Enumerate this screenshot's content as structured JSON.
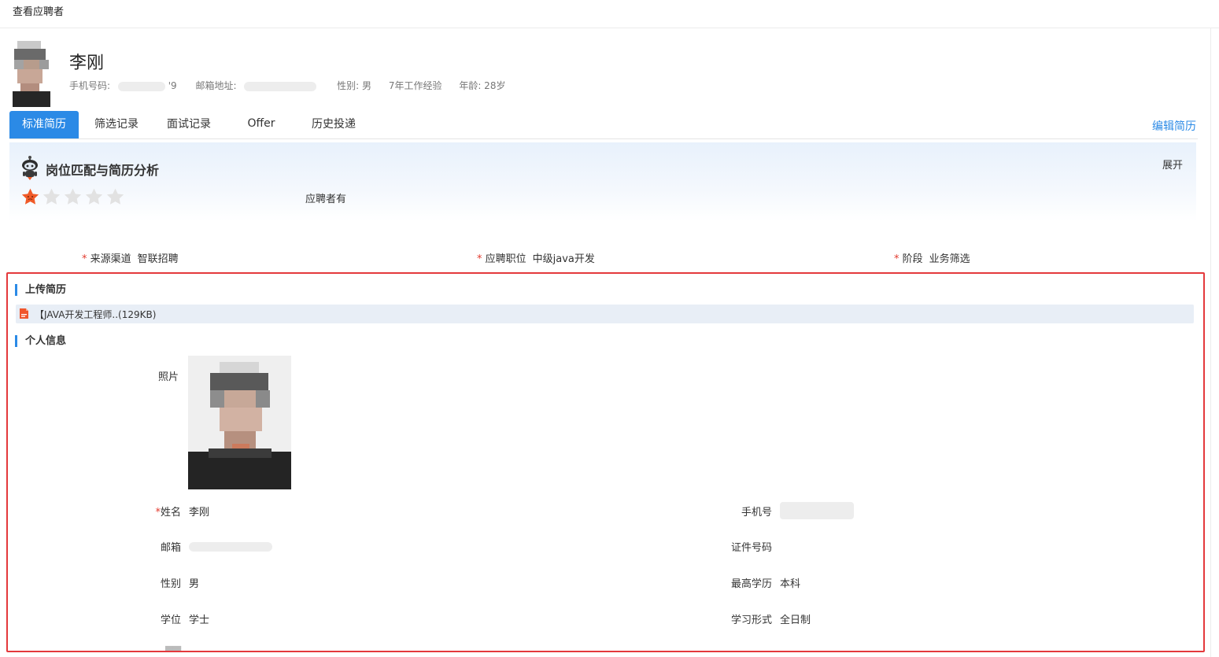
{
  "page": {
    "title": "查看应聘者"
  },
  "candidate": {
    "name": "李刚",
    "phone_label": "手机号码:",
    "phone_visible_tail": "'9",
    "email_label": "邮箱地址:",
    "gender": "性别: 男",
    "experience": "7年工作经验",
    "age": "年龄: 28岁"
  },
  "tabs": [
    {
      "label": "标准简历",
      "active": true
    },
    {
      "label": "筛选记录",
      "active": false
    },
    {
      "label": "面试记录",
      "active": false
    },
    {
      "label": "Offer",
      "active": false
    },
    {
      "label": "历史投递",
      "active": false
    }
  ],
  "edit_resume": "编辑简历",
  "analysis": {
    "title": "岗位匹配与简历分析",
    "expand": "展开",
    "rating": 1,
    "rating_max": 5,
    "text": "应聘者有"
  },
  "summary_fields": [
    {
      "label": "来源渠道",
      "value": "智联招聘"
    },
    {
      "label": "应聘职位",
      "value": "中级java开发"
    },
    {
      "label": "阶段",
      "value": "业务筛选"
    }
  ],
  "upload": {
    "title": "上传简历",
    "file_name": "【JAVA开发工程师..(129KB)"
  },
  "personal": {
    "title": "个人信息",
    "photo_label": "照片",
    "name_label": "姓名",
    "name_value": "李刚",
    "phone_label": "手机号",
    "email_label": "邮箱",
    "id_label": "证件号码",
    "gender_label": "性别",
    "gender_value": "男",
    "education_label": "最高学历",
    "education_value": "本科",
    "degree_label": "学位",
    "degree_value": "学士",
    "study_mode_label": "学习形式",
    "study_mode_value": "全日制"
  },
  "colors": {
    "primary": "#2b8ae6",
    "required": "#e23b2e",
    "highlight_border": "#e4393c",
    "star_active": "#f05a28",
    "star_inactive": "#e2e2e2"
  }
}
